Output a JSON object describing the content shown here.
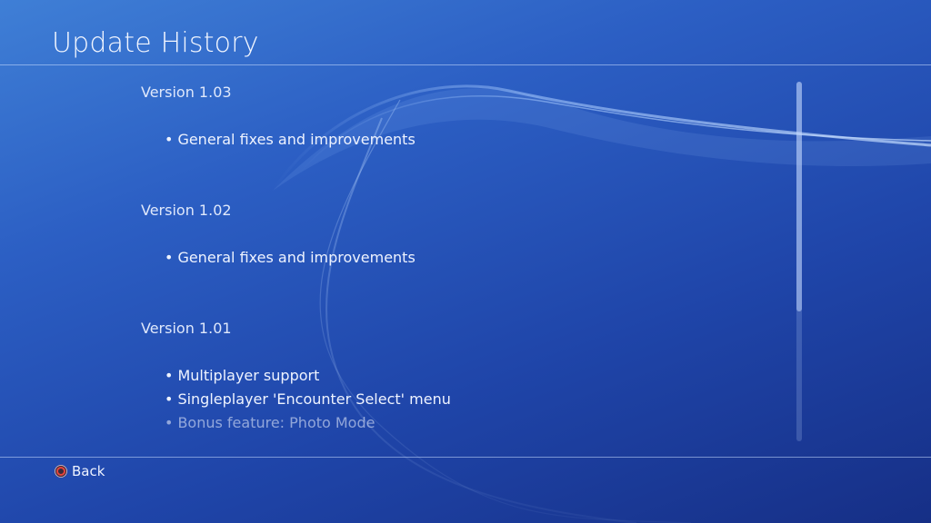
{
  "header": {
    "title": "Update History"
  },
  "versions": [
    {
      "label": "Version 1.03",
      "notes": [
        "General fixes and improvements"
      ]
    },
    {
      "label": "Version 1.02",
      "notes": [
        "General fixes and improvements"
      ]
    },
    {
      "label": "Version 1.01",
      "notes": [
        "Multiplayer support",
        "Singleplayer 'Encounter Select' menu",
        "Bonus feature: Photo Mode"
      ]
    }
  ],
  "scroll": {
    "position_fraction": 0.0,
    "visible_fraction": 0.64
  },
  "footer": {
    "back_label": "Back",
    "back_icon": "circle-button-icon"
  },
  "colors": {
    "accent_circle": "#e8453c",
    "background": "#2c5fc4"
  }
}
